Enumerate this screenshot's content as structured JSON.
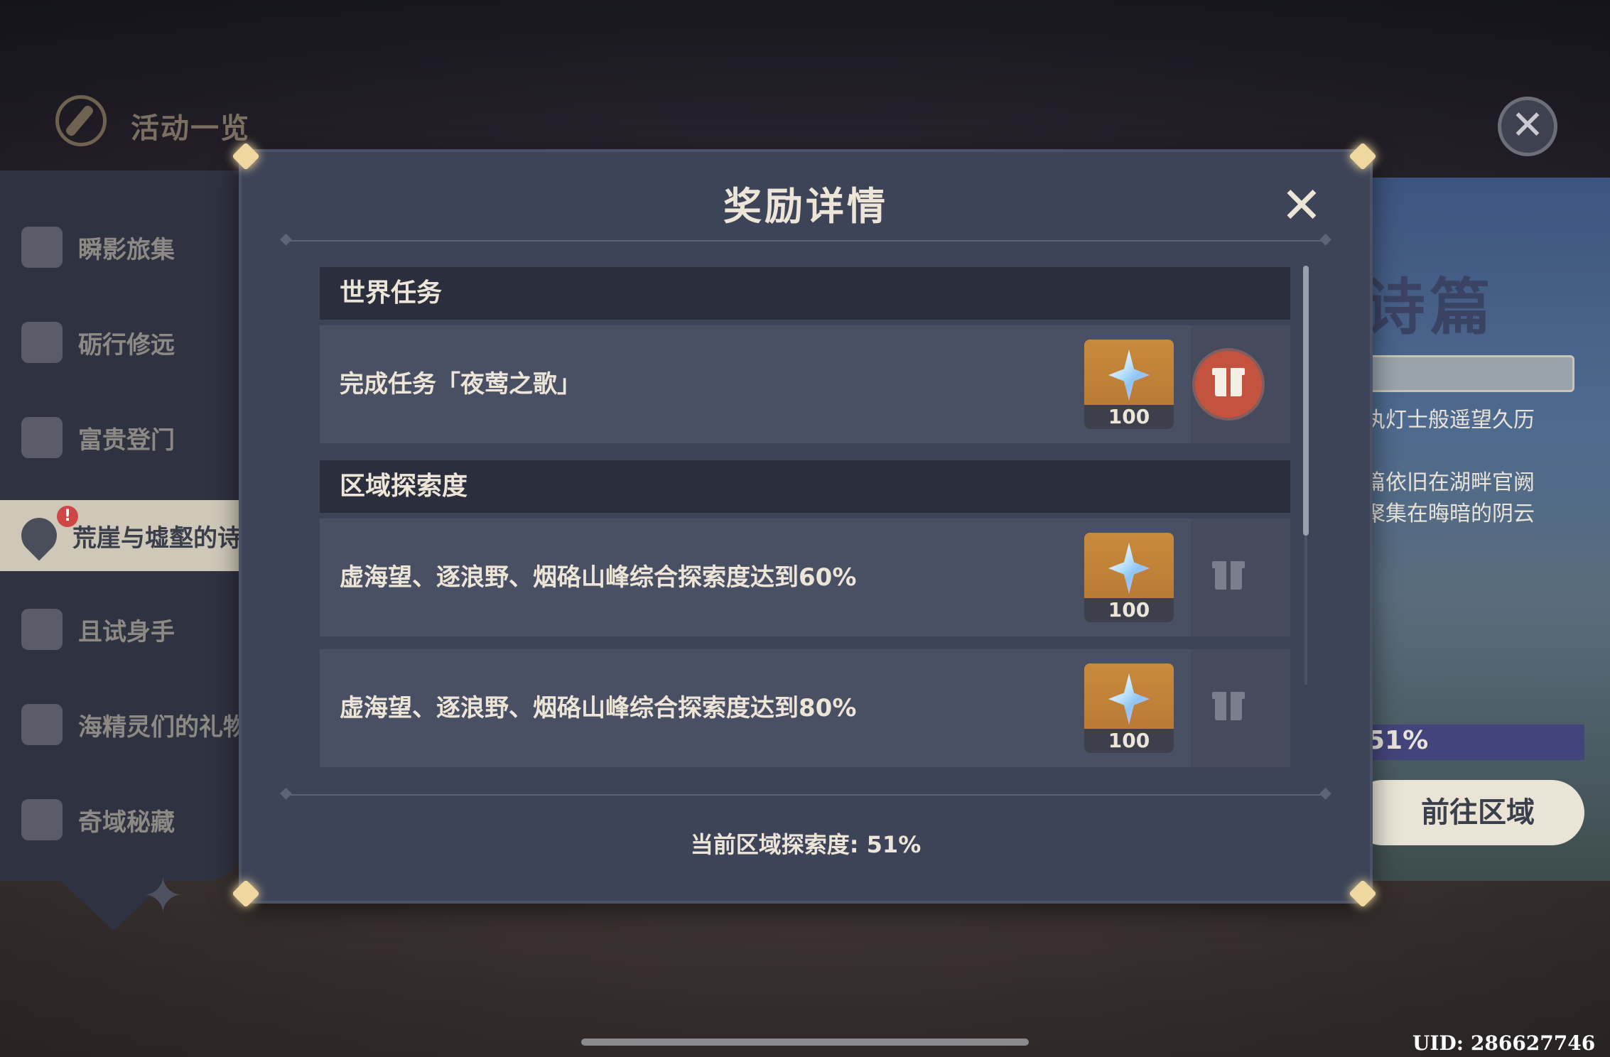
{
  "header": {
    "title": "活动一览",
    "close_icon": "close-icon"
  },
  "sidebar": {
    "items": [
      {
        "label": "瞬影旅集",
        "icon": "camera-icon"
      },
      {
        "label": "砺行修远",
        "icon": "badge-icon"
      },
      {
        "label": "富贵登门",
        "icon": "calendar-star-icon"
      },
      {
        "label": "荒崖与墟壑的诗",
        "icon": "map-pin-icon",
        "active": true,
        "alert": "!"
      },
      {
        "label": "且试身手",
        "icon": "cards-icon"
      },
      {
        "label": "海精灵们的礼物",
        "icon": "exclamation-icon"
      },
      {
        "label": "奇域秘藏",
        "icon": "sparkle-icon"
      }
    ]
  },
  "background_panel": {
    "title": "诗篇",
    "line1": "执灯士般遥望久历",
    "line2": "篇依旧在湖畔官阙",
    "line3": "聚集在晦暗的阴云",
    "progress": "51%",
    "go_button": "前往区域"
  },
  "modal": {
    "title": "奖励详情",
    "sections": [
      {
        "heading": "世界任务",
        "tasks": [
          {
            "label": "完成任务「夜莺之歌」",
            "reward_count": "100",
            "reward_icon": "primogem-icon",
            "status": "claimable"
          }
        ]
      },
      {
        "heading": "区域探索度",
        "tasks": [
          {
            "label": "虚海望、逐浪野、烟硌山峰综合探索度达到60%",
            "reward_count": "100",
            "reward_icon": "primogem-icon",
            "status": "locked"
          },
          {
            "label": "虚海望、逐浪野、烟硌山峰综合探索度达到80%",
            "reward_count": "100",
            "reward_icon": "primogem-icon",
            "status": "locked"
          }
        ]
      }
    ],
    "explore_status": "当前区域探索度: 51%"
  },
  "uid": "UID: 286627746",
  "colors": {
    "modal_bg": "#3e4457",
    "claim_red": "#c3533f",
    "reward_gold": "#c88a3c"
  }
}
